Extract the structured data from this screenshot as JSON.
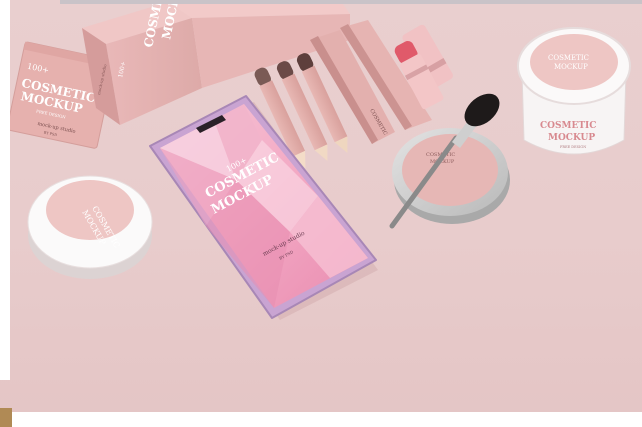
{
  "scene": {
    "background": "#e9cfcf",
    "accent_pink": "#e8b3b6",
    "gold": "#c7a46b"
  },
  "sachet": {
    "number": "100+",
    "line1": "COSMETIC",
    "line2": "MOCKUP",
    "sub": "FREE DESIGN",
    "studio": "mock-up studio",
    "by": "BY PSD"
  },
  "box": {
    "line1": "COSMETIC",
    "line2": "MOCKUP",
    "number": "100+",
    "side": "mock-up studio"
  },
  "phone": {
    "number": "100+",
    "line1": "COSMETIC",
    "line2": "MOCKUP",
    "studio": "mock-up studio",
    "by": "BY PSD"
  },
  "jar": {
    "line1": "COSMETIC",
    "line2": "MOCKUP",
    "sub": "FREE DESIGN"
  },
  "compact_round": {
    "line1": "COSMETIC",
    "line2": "MOCKUP"
  },
  "tin": {
    "line1": "COSMETIC",
    "line2": "MOCKUP"
  },
  "pencil_boxes": {
    "label": "COSMETIC"
  }
}
